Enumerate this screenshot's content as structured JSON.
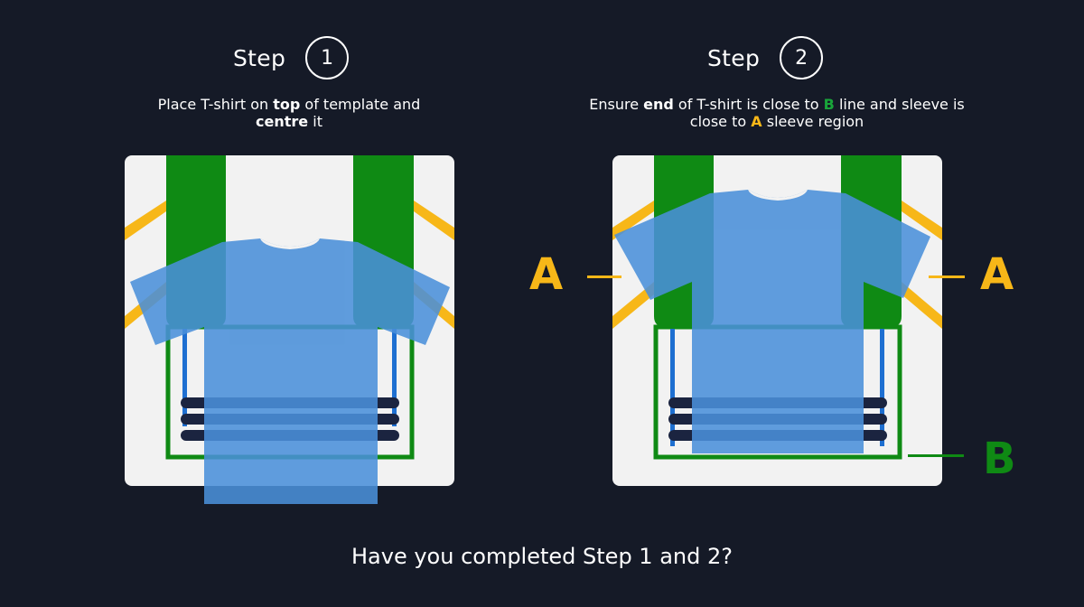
{
  "step1": {
    "label": "Step",
    "number": "1",
    "instruction_pre": "Place T-shirt on ",
    "instruction_bold1": "top",
    "instruction_mid": " of template and ",
    "instruction_bold2": "centre",
    "instruction_post": " it"
  },
  "step2": {
    "label": "Step",
    "number": "2",
    "instruction_pre": "Ensure ",
    "instruction_bold1": "end",
    "instruction_mid1": " of T-shirt is close to ",
    "instruction_hl_b": "B",
    "instruction_mid2": " line and sleeve is close to ",
    "instruction_hl_a": "A",
    "instruction_post": " sleeve region"
  },
  "markers": {
    "a_left": "A",
    "a_right": "A",
    "b": "B"
  },
  "question": "Have you completed Step 1 and 2?",
  "colors": {
    "background": "#151a27",
    "template_bg": "#f2f2f2",
    "template_green": "#0f8a14",
    "sleeve_yellow": "#f7b718",
    "shirt_blue": "#4a90d9",
    "stripe_navy": "#1b2440",
    "line_blue": "#1e6fd1"
  }
}
